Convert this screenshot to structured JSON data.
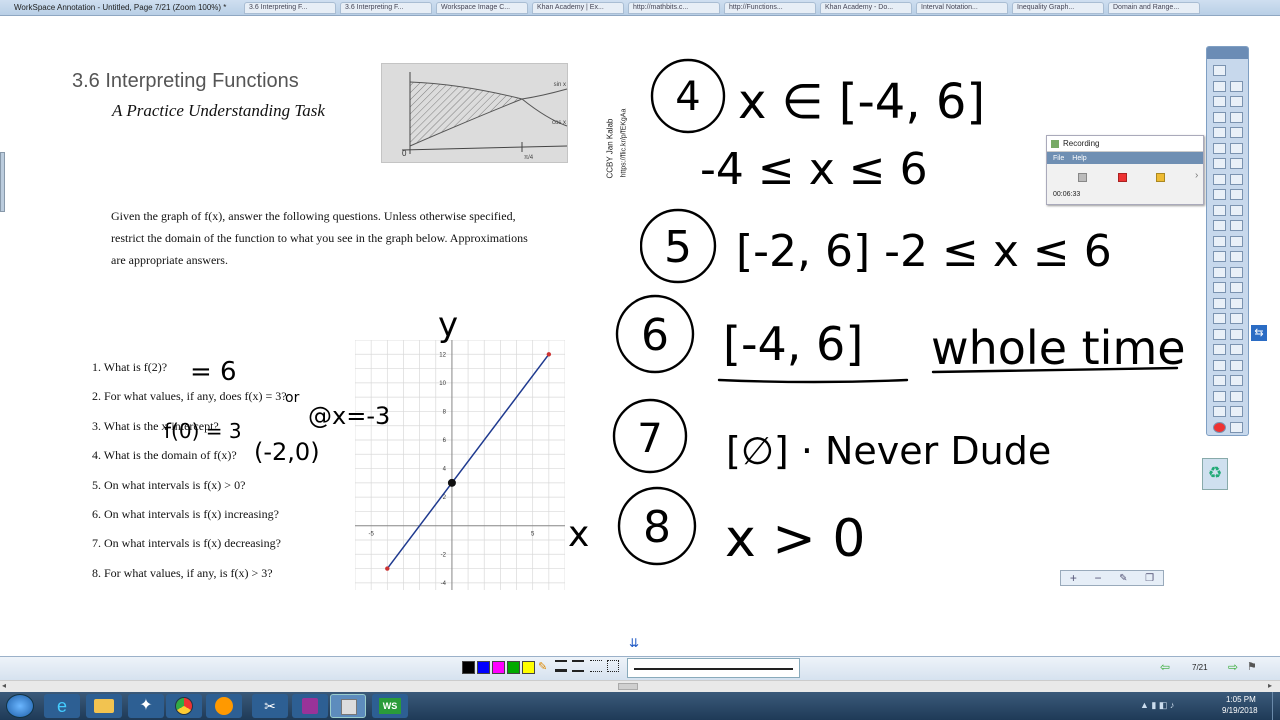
{
  "window": {
    "title": "WorkSpace Annotation - Untitled, Page 7/21  (Zoom 100%) *",
    "tabs": [
      "3.6 Interpreting F...",
      "3.6 Interpreting F...",
      "Workspace Image C...",
      "Khan Academy | Ex...",
      "http://mathbits.c...",
      "http://Functions...",
      "Khan Academy - Do...",
      "Interval Notation...",
      "Inequality Graph...",
      "Domain and Range..."
    ]
  },
  "doc": {
    "section_title": "3.6  Interpreting Functions",
    "subtitle": "A Practice Understanding Task",
    "credit_line1": "CCBY Jan Kalab",
    "credit_line2": "https://flic.kr/p/fEKgAa",
    "photo_labels": {
      "sin": "sin x",
      "cos": "cos x",
      "pi": "π/4",
      "origin": "0"
    },
    "intro_line1": "Given the graph of f(x), answer the following questions. Unless otherwise specified,",
    "intro_line2": "restrict the domain of the function to what you see in the graph below. Approximations",
    "intro_line3": "are appropriate answers.",
    "questions": [
      "1.    What is f(2)?",
      "2.    For what values, if any, does f(x) = 3?",
      "3.    What is the x-intercept?",
      "4.    What is the domain of f(x)?",
      "5.    On what intervals is f(x) > 0?",
      "6.    On what intervals is f(x) increasing?",
      "7.    On what intervals is f(x) decreasing?",
      "8.    For what values, if any, is f(x) > 3?"
    ],
    "graph_ticks": {
      "x": [
        "-5",
        "5"
      ],
      "y": [
        "12",
        "10",
        "8",
        "6",
        "4",
        "2",
        "-2",
        "-4"
      ]
    },
    "handwriting_left": {
      "a1": "= 6",
      "or": "or",
      "a2": "@x=-3",
      "a3a": "f(0) = 3",
      "a3b": "(-2,0)",
      "y_axis": "y",
      "x_axis": "x"
    }
  },
  "answers": [
    {
      "num": "4",
      "line1": "x ∈ [-4, 6]",
      "line2": "-4 ≤ x ≤ 6"
    },
    {
      "num": "5",
      "line1": "[-2, 6]  -2 ≤ x ≤ 6"
    },
    {
      "num": "6",
      "line1": "[-4, 6]",
      "line2": "whole time"
    },
    {
      "num": "7",
      "line1": "[∅]  · Never Dude"
    },
    {
      "num": "8",
      "line1": "x > 0"
    }
  ],
  "recording": {
    "title": "Recording",
    "menu_file": "File",
    "menu_help": "Help",
    "time": "00:06:33"
  },
  "bottombar": {
    "page": "7/21"
  },
  "taskbar": {
    "time": "1:05 PM",
    "date": "9/19/2018"
  },
  "colors": {
    "palette": [
      "#000000",
      "#0000ff",
      "#ff00ff",
      "#00aa00",
      "#ffff00"
    ],
    "line": "#1f3a8f"
  }
}
